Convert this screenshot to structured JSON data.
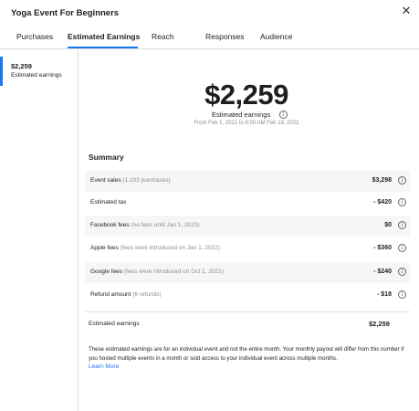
{
  "header": {
    "title": "Yoga Event For Beginners",
    "close_icon": "close-icon"
  },
  "tabs": [
    {
      "label": "Purchases",
      "active": false
    },
    {
      "label": "Estimated Earnings",
      "active": true
    },
    {
      "label": "Reach",
      "active": false
    },
    {
      "label": "Responses",
      "active": false
    },
    {
      "label": "Audience",
      "active": false
    }
  ],
  "sidebar": {
    "items": [
      {
        "value": "$2,259",
        "label": "Estimated earnings",
        "active": true
      }
    ]
  },
  "hero": {
    "value": "$2,259",
    "label": "Estimated earnings",
    "range": "From Feb 1, 2022 to 8:50 AM Feb 19, 2022"
  },
  "summary": {
    "title": "Summary",
    "rows": [
      {
        "label": "Event sales",
        "note": "(1,103 purchases)",
        "amount": "$3,298"
      },
      {
        "label": "Estimated tax",
        "note": "",
        "amount": "- $420"
      },
      {
        "label": "Facebook fees",
        "note": "(no fees until Jan 1, 2023)",
        "amount": "$0"
      },
      {
        "label": "Apple fees",
        "note": "(fees were introduced on Jan 1, 2022)",
        "amount": "- $360"
      },
      {
        "label": "Google fees",
        "note": "(fees were introduced on Oct 1, 2021)",
        "amount": "- $240"
      },
      {
        "label": "Refund amount",
        "note": "(6 refunds)",
        "amount": "- $18"
      }
    ],
    "total_label": "Estimated earnings",
    "total_amount": "$2,259"
  },
  "footer": {
    "disclaimer": "These estimated earnings are for an individual event and not the entire month. Your monthly payout will differ from this number if you hosted multiple events in a month or sold access to your individual event across multiple months.",
    "learn_more": "Learn More"
  },
  "colors": {
    "accent": "#1877f2",
    "muted": "#8a8d91",
    "row_shade": "#f5f6f7"
  }
}
